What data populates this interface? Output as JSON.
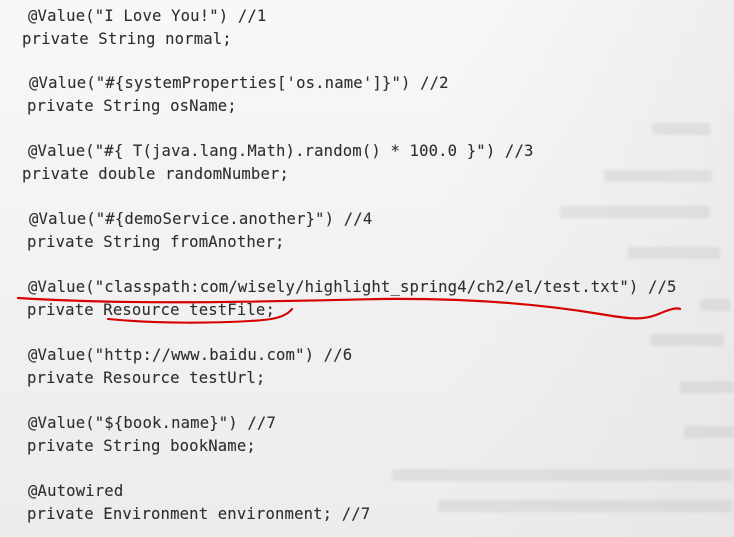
{
  "document": {
    "lines": [
      "@Value(\"I Love You!\") //1",
      "private String normal;",
      "@Value(\"#{systemProperties['os.name']}\") //2",
      "private String osName;",
      "@Value(\"#{ T(java.lang.Math).random() * 100.0 }\") //3",
      "private double randomNumber;",
      "@Value(\"#{demoService.another}\") //4",
      "private String fromAnother;",
      "@Value(\"classpath:com/wisely/highlight_spring4/ch2/el/test.txt\") //5",
      "private Resource testFile;",
      "@Value(\"http://www.baidu.com\") //6",
      "private Resource testUrl;",
      "@Value(\"${book.name}\") //7",
      "private String bookName;",
      "@Autowired",
      "private Environment environment; //7"
    ]
  },
  "annotation": {
    "color": "#d60000"
  }
}
